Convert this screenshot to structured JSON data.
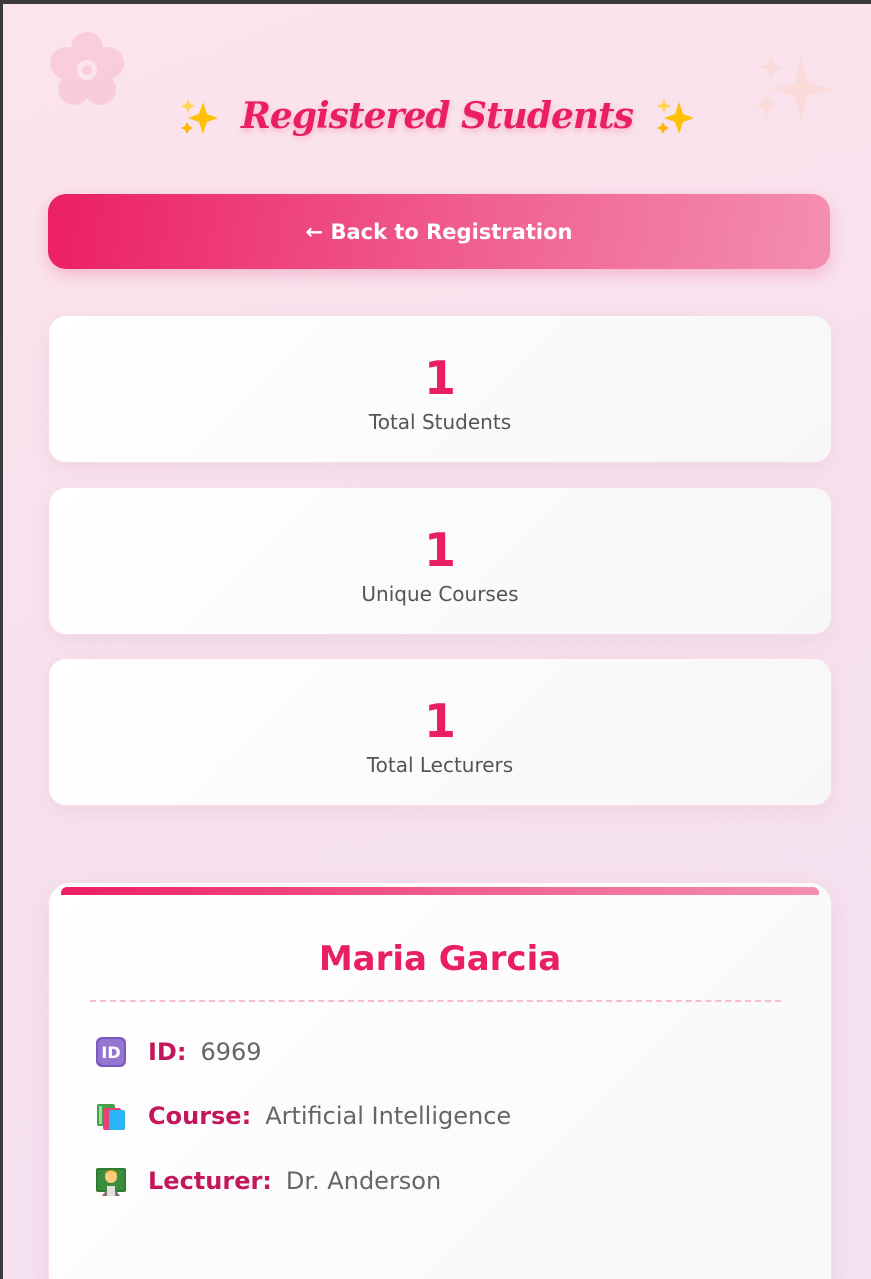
{
  "header": {
    "title": "Registered Students",
    "left_icon": "sparkles-icon",
    "right_icon": "sparkles-icon"
  },
  "back_button": {
    "label": "← Back to Registration"
  },
  "stats": [
    {
      "value": "1",
      "label": "Total Students"
    },
    {
      "value": "1",
      "label": "Unique Courses"
    },
    {
      "value": "1",
      "label": "Total Lecturers"
    }
  ],
  "students": [
    {
      "name": "Maria Garcia",
      "id_label": "ID:",
      "id_value": "6969",
      "course_label": "Course:",
      "course_value": "Artificial Intelligence",
      "lecturer_label": "Lecturer:",
      "lecturer_value": "Dr. Anderson"
    }
  ],
  "colors": {
    "accent": "#e91e63",
    "accent_light": "#f48fb1",
    "label_dark": "#c2185b",
    "text_gray": "#555555",
    "background": "#fce4ec"
  }
}
